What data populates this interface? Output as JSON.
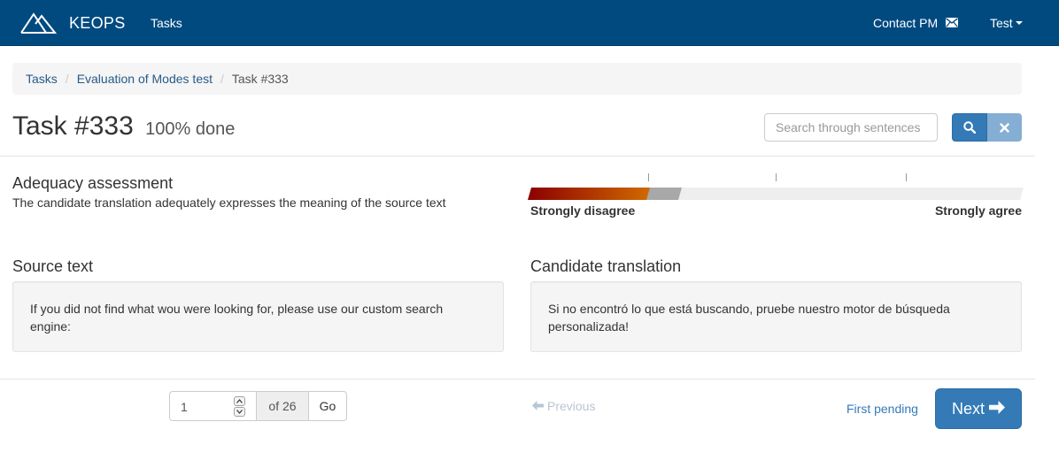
{
  "navbar": {
    "brand": "KEOPS",
    "tasks_link": "Tasks",
    "contact_label": "Contact PM",
    "contact_icon": "envelope-icon",
    "user_label": "Test",
    "background": "#004a80"
  },
  "breadcrumb": {
    "items": [
      "Tasks",
      "Evaluation of Modes test",
      "Task #333"
    ]
  },
  "task": {
    "title": "Task #333",
    "progress_label": "100% done"
  },
  "search": {
    "placeholder": "Search through sentences",
    "search_icon": "search-icon",
    "clear_icon": "close-icon",
    "accent": "#337ab7"
  },
  "assessment": {
    "title": "Adequacy assessment",
    "description": "The candidate translation adequately expresses the meaning of the source text",
    "min_label": "Strongly disagree",
    "max_label": "Strongly agree",
    "value_fraction": 0.24,
    "gradient_colors": [
      "#8b0000",
      "#d06a00"
    ]
  },
  "source": {
    "title": "Source text",
    "text": "If you did not find what wou were looking for, please use our custom search engine:"
  },
  "candidate": {
    "title": "Candidate translation",
    "text": "Si no encontró lo que está buscando, pruebe nuestro motor de búsqueda personalizada!"
  },
  "pagination": {
    "current_page": "1",
    "of_label": "of 26",
    "go_label": "Go",
    "previous_label": "Previous",
    "first_pending_label": "First pending",
    "next_label": "Next"
  }
}
